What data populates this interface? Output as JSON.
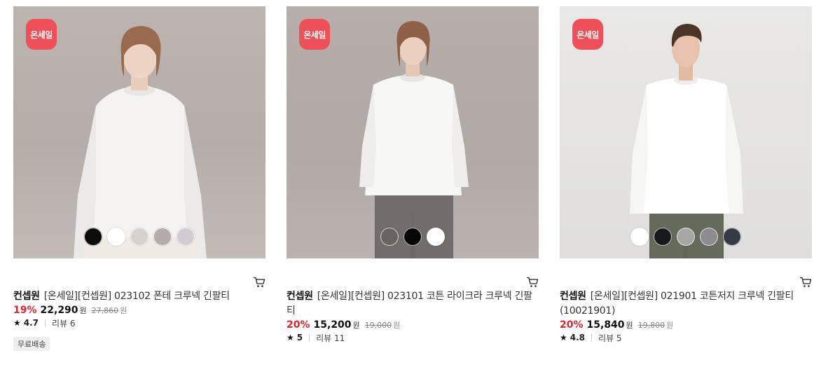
{
  "products": [
    {
      "badge": "온세일",
      "brand": "컨셉원",
      "name": "[온세일][컨셉원] 023102 폰테 크루넥 긴팔티",
      "discount": "19%",
      "price": "22,290",
      "currency": "원",
      "original_price": "27,860",
      "rating": "4.7",
      "review_label": "리뷰 6",
      "tag": "무료배송",
      "swatches": [
        "#0c0c0c",
        "#ffffff",
        "#d7d1ce",
        "#b6aaad",
        "#d2cbd4"
      ],
      "background": "#b9b1ad"
    },
    {
      "badge": "온세일",
      "brand": "컨셉원",
      "name": "[온세일][컨셉원] 023101 코튼 라이크라 크루넥 긴팔티",
      "discount": "20%",
      "price": "15,200",
      "currency": "원",
      "original_price": "19,000",
      "rating": "5",
      "review_label": "리뷰 11",
      "swatches": [
        "#6a625f",
        "#050505",
        "#ffffff"
      ],
      "background": "#b4aca9"
    },
    {
      "badge": "온세일",
      "brand": "컨셉원",
      "name": "[온세일][컨셉원] 021901 코튼저지 크루넥 긴팔티 (10021901)",
      "discount": "20%",
      "price": "15,840",
      "currency": "원",
      "original_price": "19,800",
      "rating": "4.8",
      "review_label": "리뷰 5",
      "swatches": [
        "#ffffff",
        "#17191d",
        "#a8a6a5",
        "#8e8c90",
        "#343b46"
      ],
      "background": "#e5e4e2"
    }
  ],
  "colors": {
    "badge": "#ef4f57",
    "discount": "#e3232c"
  },
  "icons": {
    "cart": "cart-icon",
    "star": "star-icon"
  }
}
